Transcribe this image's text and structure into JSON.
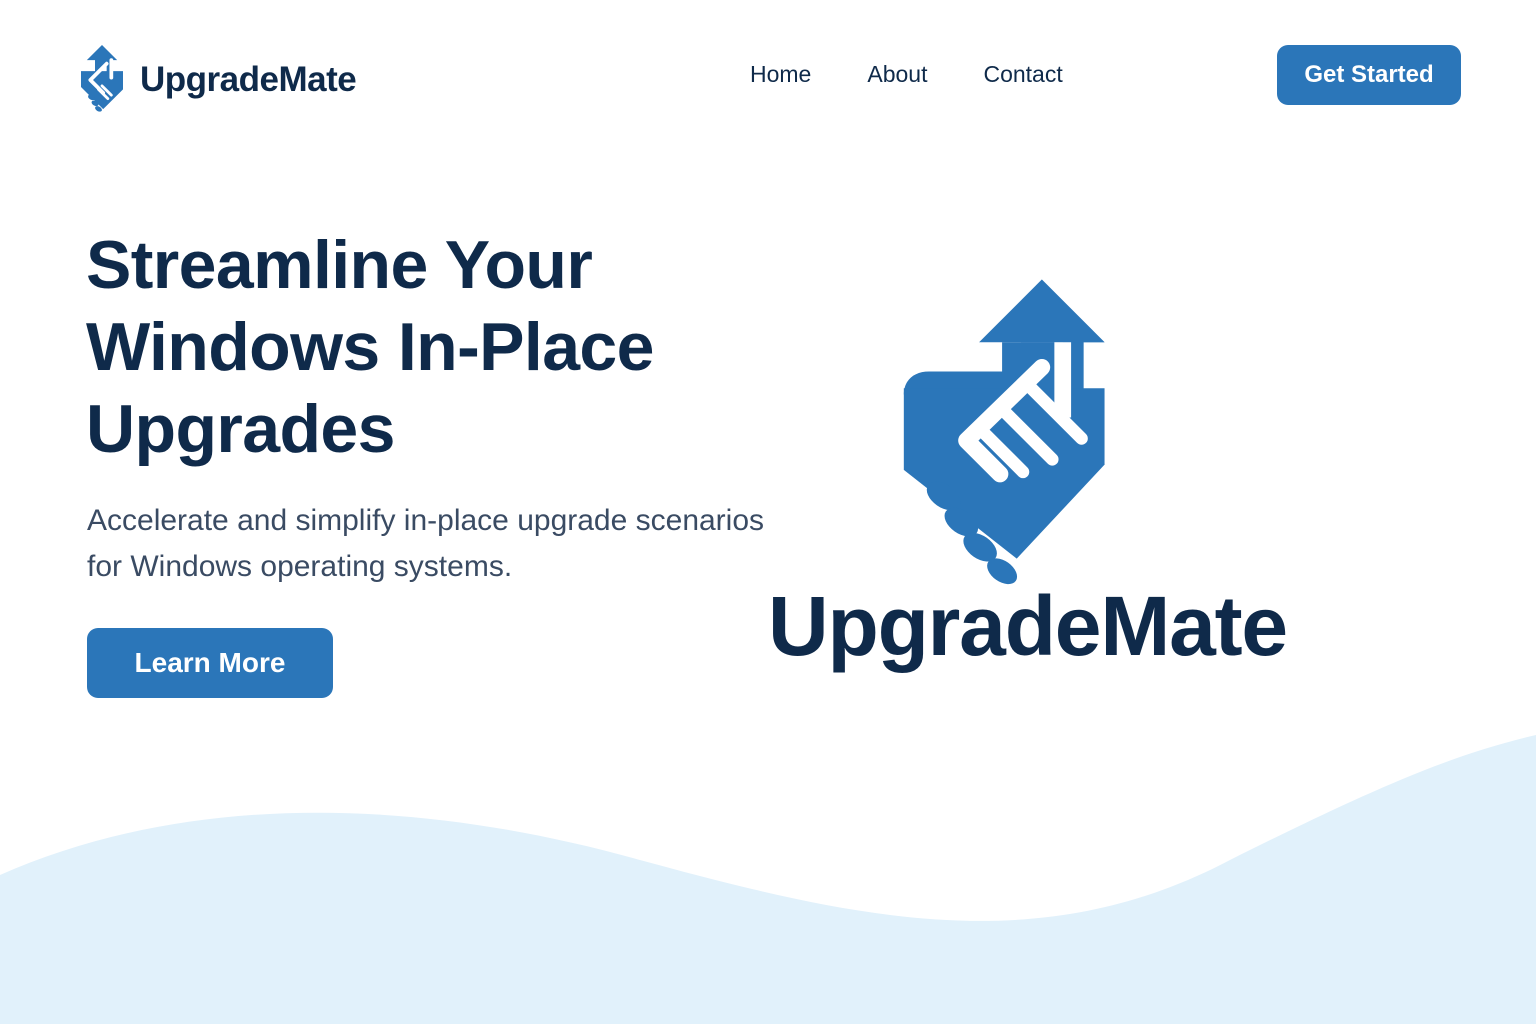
{
  "header": {
    "brand_name": "UpgradeMate",
    "nav": [
      {
        "label": "Home"
      },
      {
        "label": "About"
      },
      {
        "label": "Contact"
      }
    ],
    "cta_label": "Get Started"
  },
  "hero": {
    "title": "Streamline Your Windows In-Place Upgrades",
    "subtitle": "Accelerate and simplify in-place upgrade scenarios for Windows operating systems.",
    "cta_label": "Learn More",
    "logo_wordmark": "UpgradeMate"
  },
  "icons": {
    "brand_logo": "handshake-upload-icon",
    "hero_logo": "handshake-upload-icon"
  },
  "colors": {
    "primary": "#2b76b9",
    "heading": "#0f2a4a",
    "body_text": "#3a4b63",
    "wave": "#e1f1fb",
    "background": "#ffffff"
  }
}
